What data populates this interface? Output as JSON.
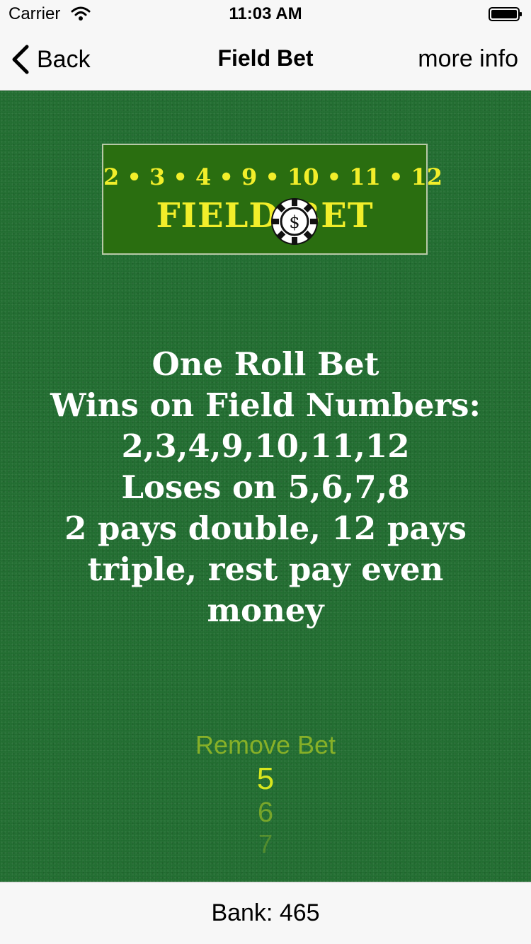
{
  "status_bar": {
    "carrier": "Carrier",
    "time": "11:03 AM"
  },
  "nav": {
    "back_label": "Back",
    "title": "Field Bet",
    "more_info_label": "more info"
  },
  "logo": {
    "numbers": "2 • 3 • 4 • 9 • 10 • 11 • 12",
    "word": "FIELD BET",
    "chip_symbol": "$"
  },
  "description": {
    "lines": [
      "One Roll Bet",
      "Wins on Field Numbers:",
      "2,3,4,9,10,11,12",
      "Loses on 5,6,7,8",
      "2 pays double, 12 pays",
      "triple, rest pay even",
      "money"
    ]
  },
  "picker": {
    "options": [
      "Remove Bet",
      "5",
      "6",
      "7"
    ],
    "selected": "5"
  },
  "bank": {
    "label": "Bank: 465"
  },
  "colors": {
    "felt": "#1f6b2e",
    "logo_background": "#2a6e10",
    "logo_text": "#f2ee2a",
    "picker_text": "#d7e61e",
    "bar_background": "#f7f7f7"
  }
}
